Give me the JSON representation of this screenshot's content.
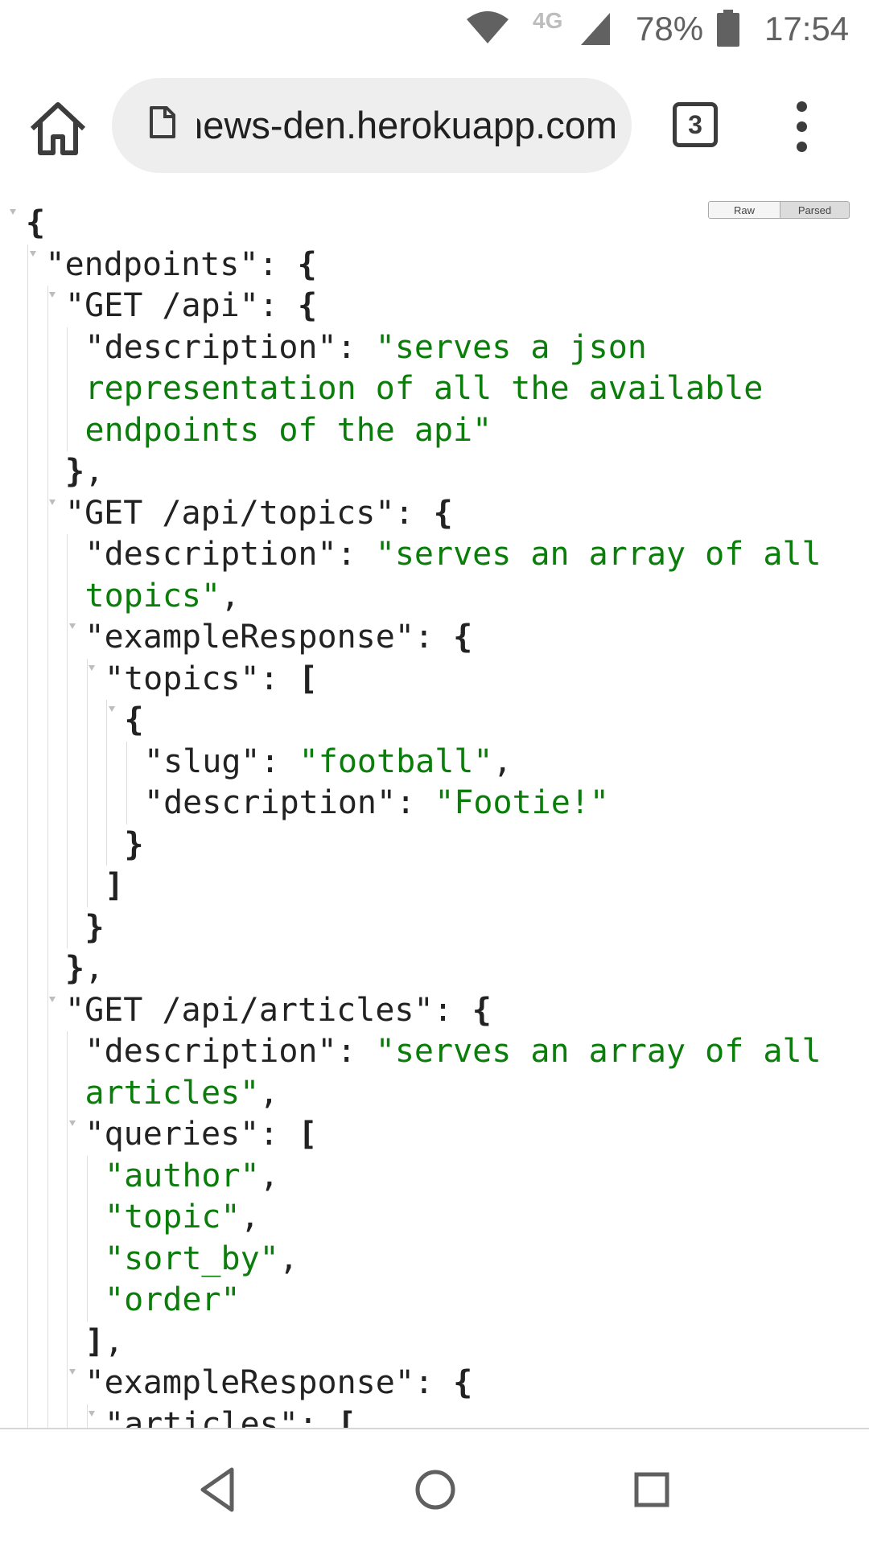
{
  "status_bar": {
    "network_type": "4G",
    "battery_percent": "78%",
    "time": "17:54",
    "icons": [
      "wifi-icon",
      "cell-signal-icon",
      "battery-icon"
    ]
  },
  "toolbar": {
    "url": "news-den.herokuapp.com",
    "tab_count": "3",
    "icons": [
      "home-icon",
      "page-icon",
      "more-vert-icon"
    ]
  },
  "viewer_toggle": {
    "raw_label": "Raw",
    "parsed_label": "Parsed",
    "selected": "Parsed"
  },
  "json_lines": [
    {
      "parts": [
        {
          "t": "{",
          "k": "br"
        }
      ]
    },
    {
      "parts": [
        {
          "t": "\"endpoints\": "
        },
        {
          "t": "{",
          "k": "br"
        }
      ]
    },
    {
      "parts": [
        {
          "t": "\"GET /api\": "
        },
        {
          "t": "{",
          "k": "br"
        }
      ]
    },
    {
      "parts": [
        {
          "t": "\"description\": "
        },
        {
          "t": "\"serves a json",
          "k": "str"
        }
      ]
    },
    {
      "parts": [
        {
          "t": "representation of all the available",
          "k": "str"
        }
      ]
    },
    {
      "parts": [
        {
          "t": "endpoints of the api\"",
          "k": "str"
        }
      ]
    },
    {
      "parts": [
        {
          "t": "}",
          "k": "br"
        },
        {
          "t": ","
        }
      ]
    },
    {
      "parts": [
        {
          "t": "\"GET /api/topics\": "
        },
        {
          "t": "{",
          "k": "br"
        }
      ]
    },
    {
      "parts": [
        {
          "t": "\"description\": "
        },
        {
          "t": "\"serves an array of all",
          "k": "str"
        }
      ]
    },
    {
      "parts": [
        {
          "t": "topics\"",
          "k": "str"
        },
        {
          "t": ","
        }
      ]
    },
    {
      "parts": [
        {
          "t": "\"exampleResponse\": "
        },
        {
          "t": "{",
          "k": "br"
        }
      ]
    },
    {
      "parts": [
        {
          "t": "\"topics\": "
        },
        {
          "t": "[",
          "k": "br"
        }
      ]
    },
    {
      "parts": [
        {
          "t": "{",
          "k": "br"
        }
      ]
    },
    {
      "parts": [
        {
          "t": "\"slug\": "
        },
        {
          "t": "\"football\"",
          "k": "str"
        },
        {
          "t": ","
        }
      ]
    },
    {
      "parts": [
        {
          "t": "\"description\": "
        },
        {
          "t": "\"Footie!\"",
          "k": "str"
        }
      ]
    },
    {
      "parts": [
        {
          "t": "}",
          "k": "br"
        }
      ]
    },
    {
      "parts": [
        {
          "t": "]",
          "k": "br"
        }
      ]
    },
    {
      "parts": [
        {
          "t": "}",
          "k": "br"
        }
      ]
    },
    {
      "parts": [
        {
          "t": "}",
          "k": "br"
        },
        {
          "t": ","
        }
      ]
    },
    {
      "parts": [
        {
          "t": "\"GET /api/articles\": "
        },
        {
          "t": "{",
          "k": "br"
        }
      ]
    },
    {
      "parts": [
        {
          "t": "\"description\": "
        },
        {
          "t": "\"serves an array of all",
          "k": "str"
        }
      ]
    },
    {
      "parts": [
        {
          "t": "articles\"",
          "k": "str"
        },
        {
          "t": ","
        }
      ]
    },
    {
      "parts": [
        {
          "t": "\"queries\": "
        },
        {
          "t": "[",
          "k": "br"
        }
      ]
    },
    {
      "parts": [
        {
          "t": "\"author\"",
          "k": "str"
        },
        {
          "t": ","
        }
      ]
    },
    {
      "parts": [
        {
          "t": "\"topic\"",
          "k": "str"
        },
        {
          "t": ","
        }
      ]
    },
    {
      "parts": [
        {
          "t": "\"sort_by\"",
          "k": "str"
        },
        {
          "t": ","
        }
      ]
    },
    {
      "parts": [
        {
          "t": "\"order\"",
          "k": "str"
        }
      ]
    },
    {
      "parts": [
        {
          "t": "]",
          "k": "br"
        },
        {
          "t": ","
        }
      ]
    },
    {
      "parts": [
        {
          "t": "\"exampleResponse\": "
        },
        {
          "t": "{",
          "k": "br"
        }
      ]
    },
    {
      "parts": [
        {
          "t": "\"articles\": "
        },
        {
          "t": "[",
          "k": "br"
        }
      ]
    }
  ],
  "nav_bar": {
    "icons": [
      "back-icon",
      "home-circle-icon",
      "recents-icon"
    ]
  },
  "colors": {
    "json_string": "#0a7d0a",
    "json_key": "#222222",
    "omnibox_bg": "#eeeeee"
  }
}
